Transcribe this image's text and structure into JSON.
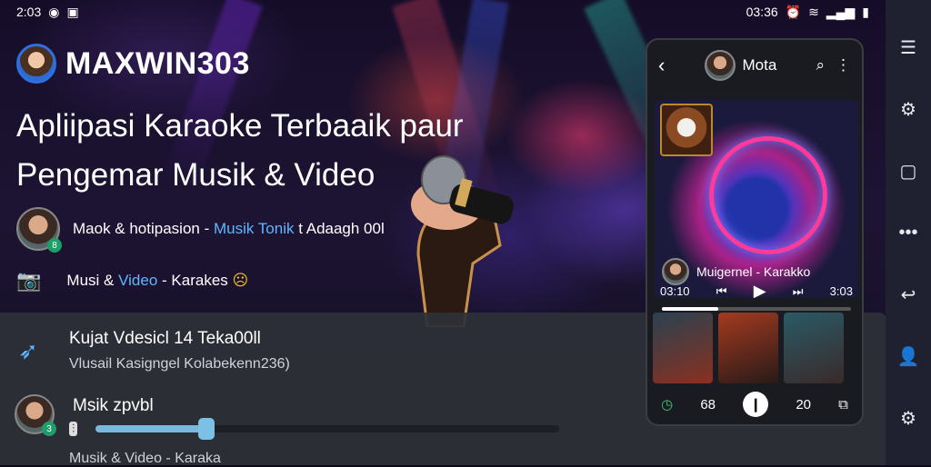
{
  "status_bar": {
    "time_left": "2:03",
    "time_right": "03:36"
  },
  "header": {
    "brand": "MAXWIN303"
  },
  "hero": {
    "headline_line1": "Apliipasi Karaoke Terbaaik paur",
    "headline_line2": "Pengemar Musik & Video",
    "artist_line_prefix": "Maok & hotipasion -",
    "artist_line_accent": "Musik Tonik",
    "artist_line_suffix": "t Adaagh 00l",
    "row2_part1": "Musi &",
    "row2_accent": "Video",
    "row2_part2": "- Karakes"
  },
  "bottom_panel": {
    "item1_title": "Kujat Vdesicl  14 Teka00ll",
    "item1_sub": "Vlusail Kasigngel Kolabekenn236)",
    "item2_title": "Msik zpvbl",
    "item2_badge": "3",
    "slider_value_fraction": 0.24,
    "item3_title": "Musik & Video - Karaka"
  },
  "player": {
    "contact_name": "Mota",
    "caption": "Muigernel - Karakko",
    "time_elapsed": "03:10",
    "time_total": "3:03",
    "progress_fraction": 0.3,
    "nav_left": "68",
    "nav_right": "20"
  },
  "colors": {
    "accent": "#5fb6ff",
    "slider": "#79b9dc",
    "panel": "#2e3038"
  },
  "icons": [
    "menu-icon",
    "settings-icon",
    "square-icon",
    "more-icon",
    "back-icon",
    "person-icon",
    "settings-alt-icon"
  ]
}
